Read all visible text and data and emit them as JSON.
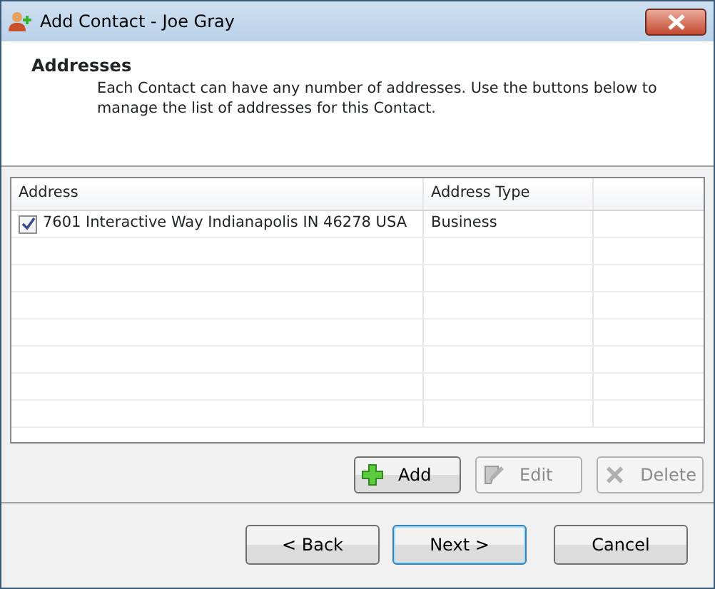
{
  "window": {
    "title": "Add Contact - Joe Gray"
  },
  "header": {
    "title": "Addresses",
    "description": "Each Contact can have any number of addresses.  Use the buttons below to manage the list of addresses for this Contact."
  },
  "table": {
    "columns": [
      "Address",
      "Address Type"
    ],
    "rows": [
      {
        "checked": true,
        "cells": [
          "7601 Interactive Way Indianapolis IN 46278 USA",
          "Business"
        ]
      }
    ]
  },
  "toolbar": [
    {
      "kind": "add",
      "label": "Add",
      "disabled": false
    },
    {
      "kind": "edit",
      "label": "Edit",
      "disabled": true
    },
    {
      "kind": "delete",
      "label": "Delete",
      "disabled": true
    }
  ],
  "buttons": [
    {
      "label": "< Back",
      "focused": false
    },
    {
      "label": "Next >",
      "focused": true
    },
    {
      "label": "Cancel",
      "focused": false
    }
  ]
}
